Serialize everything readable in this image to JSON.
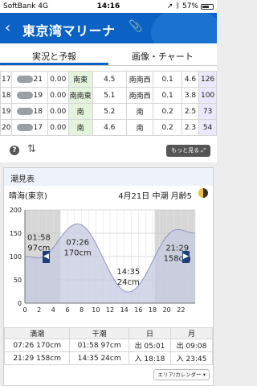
{
  "status": {
    "carrier": "SoftBank",
    "network": "4G",
    "time": "14:16",
    "battery": "57%"
  },
  "header": {
    "title": "東京湾マリーナ",
    "back_icon": "chevron-left-icon",
    "clip_icon": "paperclip-icon",
    "title_color": "#ffffff",
    "bar_color": "#0b62c4"
  },
  "tabs": [
    {
      "label": "実況と予報"
    },
    {
      "label": "画像・チャート"
    }
  ],
  "forecast": {
    "rows": [
      {
        "hour": "17",
        "temp": "21",
        "precip": "0.00",
        "wind_dir": "南東",
        "wind_speed": "4.5",
        "wave_dir": "南南西",
        "wave_h": "0.1",
        "period": "4.6",
        "extra": "126"
      },
      {
        "hour": "18",
        "temp": "19",
        "precip": "0.00",
        "wind_dir": "南南東",
        "wind_speed": "5.1",
        "wave_dir": "南南西",
        "wave_h": "0.1",
        "period": "3.8",
        "extra": "100"
      },
      {
        "hour": "19",
        "temp": "18",
        "precip": "0.00",
        "wind_dir": "南",
        "wind_speed": "5.2",
        "wave_dir": "南",
        "wave_h": "0.2",
        "period": "2.5",
        "extra": "73"
      },
      {
        "hour": "20",
        "temp": "17",
        "precip": "0.00",
        "wind_dir": "南",
        "wind_speed": "4.6",
        "wave_dir": "南",
        "wave_h": "0.2",
        "period": "2.3",
        "extra": "54"
      }
    ]
  },
  "toolbar": {
    "help_icon": "question-circle-icon",
    "sort_icon": "swap-vertical-icon",
    "more_label": "もっと見る"
  },
  "tide": {
    "section_title": "潮見表",
    "location": "晴海(東京)",
    "date_info": "4月21日  中潮  月齢5",
    "moon_icon": "moon-phase-icon",
    "left_nav_icon": "chevron-left-icon",
    "right_nav_icon": "chevron-right-icon",
    "headers": [
      "満潮",
      "干潮",
      "日",
      "月"
    ],
    "rows": [
      [
        "07:26 170cm",
        "01:58 97cm",
        "出 05:01",
        "出 09:08"
      ],
      [
        "21:29 158cm",
        "14:35 24cm",
        "入 18:18",
        "入 23:45"
      ]
    ],
    "footer_button": "エリア/カレンダー ▾"
  },
  "chart_data": {
    "type": "area",
    "x": [
      0,
      1.97,
      7.43,
      14.58,
      21.48,
      24
    ],
    "y": [
      100,
      97,
      170,
      24,
      158,
      150
    ],
    "xlim": [
      0,
      24
    ],
    "ylim": [
      0,
      200
    ],
    "x_ticks": [
      "0",
      "2",
      "4",
      "6",
      "8",
      "10",
      "12",
      "14",
      "16",
      "18",
      "20",
      "22"
    ],
    "y_ticks": [
      "0",
      "50",
      "100",
      "150",
      "200"
    ],
    "annotations": [
      {
        "time": "01:58",
        "height": "97cm"
      },
      {
        "time": "07:26",
        "height": "170cm"
      },
      {
        "time": "14:35",
        "height": "24cm"
      },
      {
        "time": "21:29",
        "height": "158cm"
      }
    ],
    "night_ranges": [
      [
        0,
        5.02
      ],
      [
        18.3,
        24
      ]
    ],
    "fill_color": "#c6c9df",
    "line_color": "#8f95c2",
    "night_color": "#d7d7d7"
  }
}
